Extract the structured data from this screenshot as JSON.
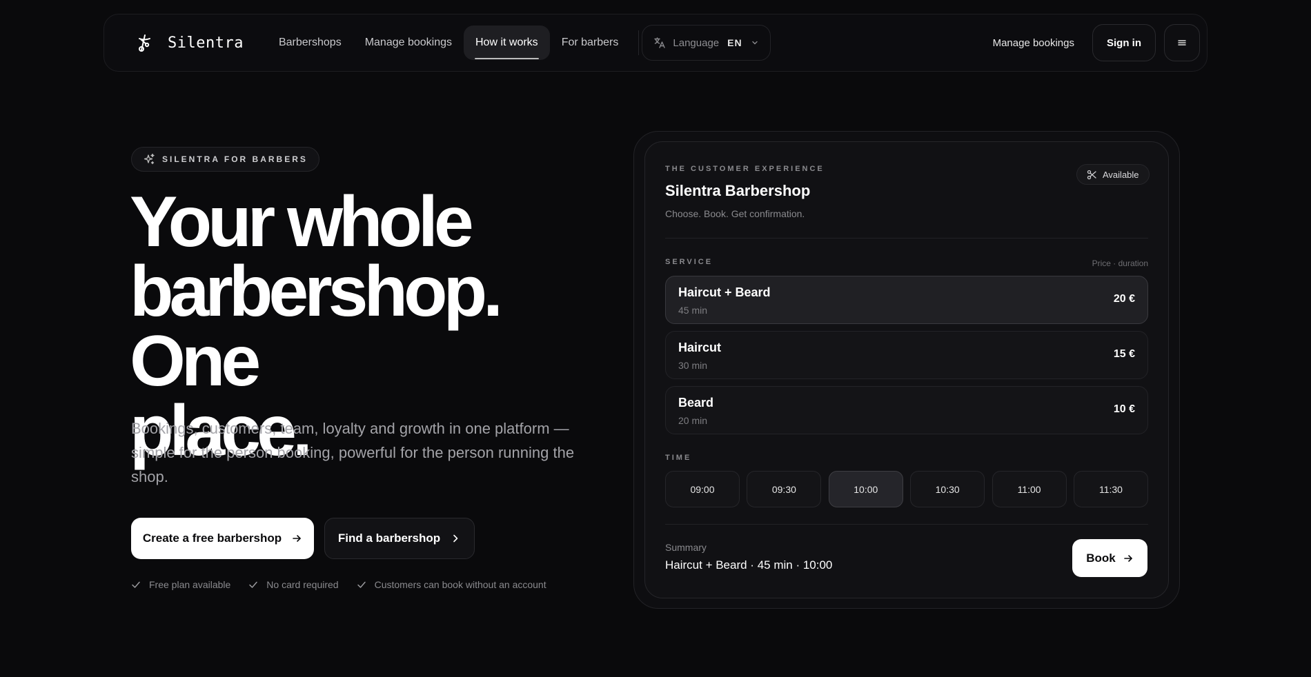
{
  "nav": {
    "brand": "Silentra",
    "links": [
      "Barbershops",
      "Manage bookings",
      "How it works",
      "For barbers"
    ],
    "active_index": 2,
    "language_label": "Language",
    "language_code": "EN",
    "manage_bookings": "Manage bookings",
    "sign_in": "Sign in"
  },
  "hero": {
    "badge": "SILENTRA FOR BARBERS",
    "headline_lines": [
      "Your whole",
      "barbershop. One",
      "place."
    ],
    "subtitle": "Bookings, customers, team, loyalty and growth in one platform — simple for the person booking, powerful for the person running the shop.",
    "cta_primary": "Create a free barbershop",
    "cta_secondary": "Find a barbershop",
    "checks": [
      "Free plan available",
      "No card required",
      "Customers can book without an account"
    ]
  },
  "card": {
    "eyebrow": "THE CUSTOMER EXPERIENCE",
    "title": "Silentra Barbershop",
    "tagline": "Choose. Book. Get confirmation.",
    "status": "Available",
    "service_label": "SERVICE",
    "service_hint": "Price · duration",
    "services": [
      {
        "name": "Haircut + Beard",
        "duration": "45 min",
        "price": "20 €",
        "selected": true
      },
      {
        "name": "Haircut",
        "duration": "30 min",
        "price": "15 €",
        "selected": false
      },
      {
        "name": "Beard",
        "duration": "20 min",
        "price": "10 €",
        "selected": false
      }
    ],
    "time_label": "TIME",
    "times": [
      "09:00",
      "09:30",
      "10:00",
      "10:30",
      "11:00",
      "11:30"
    ],
    "selected_time_index": 2,
    "summary_label": "Summary",
    "summary_value": "Haircut + Beard · 45 min · 10:00",
    "book_label": "Book"
  }
}
